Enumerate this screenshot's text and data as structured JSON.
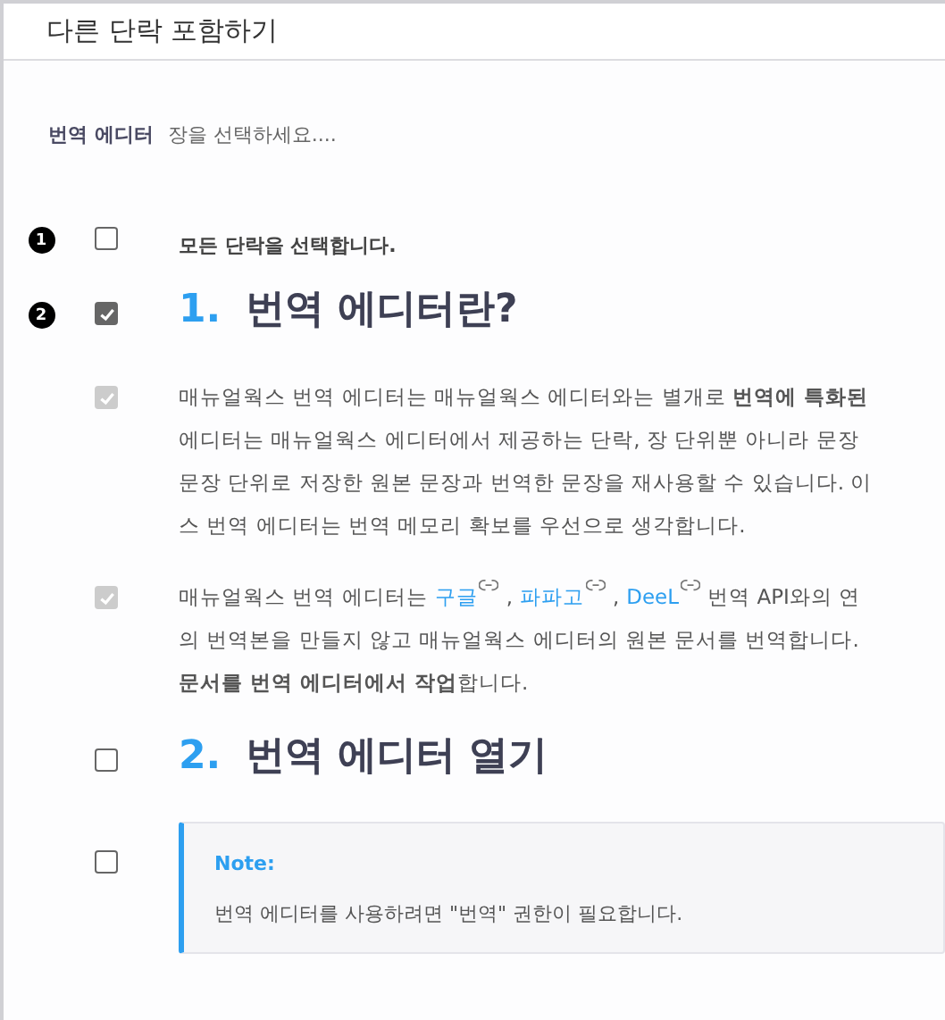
{
  "dialog": {
    "title": "다른 단락 포함하기"
  },
  "target": {
    "label": "번역 에디터",
    "placeholder": "장을 선택하세요...."
  },
  "items": [
    {
      "kind": "option",
      "badge": "1",
      "checked": false,
      "disabled": false,
      "text": "모든 단락을 선택합니다."
    },
    {
      "kind": "heading",
      "badge": "2",
      "checked": true,
      "disabled": false,
      "number": "1.",
      "text": "번역 에디터란?"
    },
    {
      "kind": "paragraph",
      "checked": true,
      "disabled": true,
      "lines": [
        [
          {
            "text": "매뉴얼웍스 번역 에디터는 매뉴얼웍스 에디터와는 별개로 **번역에 특화된**",
            "link": false
          }
        ],
        [
          {
            "text": "에디터는 매뉴얼웍스 에디터에서 제공하는 단락, 장 단위뿐 아니라 문장",
            "link": false
          }
        ],
        [
          {
            "text": "문장 단위로 저장한 원본 문장과 번역한 문장을 재사용할 수 있습니다. 이",
            "link": false
          }
        ],
        [
          {
            "text": "스 번역 에디터는 번역 메모리 확보를 우선으로 생각합니다.",
            "link": false
          }
        ]
      ]
    },
    {
      "kind": "paragraph",
      "checked": true,
      "disabled": true,
      "lines": [
        [
          {
            "text": "매뉴얼웍스 번역 에디터는",
            "link": false
          },
          {
            "text": "구글",
            "link": true
          },
          {
            "text": ",",
            "link": false
          },
          {
            "text": "파파고",
            "link": true
          },
          {
            "text": ",",
            "link": false
          },
          {
            "text": "DeeL",
            "link": true
          },
          {
            "text": "번역 API와의 연",
            "link": false
          }
        ],
        [
          {
            "text": "의 번역본을 만들지 않고 매뉴얼웍스 에디터의 원본 문서를 번역합니다.",
            "link": false
          }
        ],
        [
          {
            "text": "**문서를 번역 에디터에서 작업**합니다.",
            "link": false
          }
        ]
      ]
    },
    {
      "kind": "heading",
      "checked": false,
      "disabled": false,
      "number": "2.",
      "text": "번역 에디터 열기"
    },
    {
      "kind": "note",
      "checked": false,
      "disabled": false,
      "title": "Note:",
      "text": "번역 에디터를 사용하려면 \"번역\" 권한이 필요합니다."
    }
  ]
}
